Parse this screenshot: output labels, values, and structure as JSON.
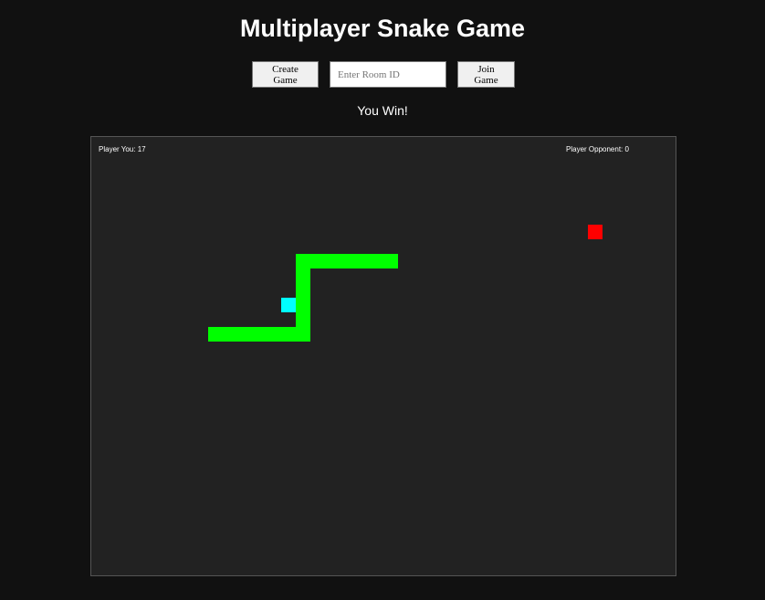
{
  "header": {
    "title": "Multiplayer Snake Game"
  },
  "controls": {
    "create_label": "Create Game",
    "room_placeholder": "Enter Room ID",
    "room_value": "",
    "join_label": "Join Game"
  },
  "status": {
    "message": "You Win!"
  },
  "board": {
    "score_you_label": "Player You: 17",
    "score_opponent_label": "Player Opponent: 0",
    "grid_cols": 40,
    "grid_rows": 30,
    "colors": {
      "background": "#222222",
      "snake_you": "#00ff00",
      "snake_opponent": "#00ffff",
      "food": "#ff0000"
    },
    "snake_you": [
      [
        8,
        13
      ],
      [
        9,
        13
      ],
      [
        10,
        13
      ],
      [
        11,
        13
      ],
      [
        12,
        13
      ],
      [
        13,
        13
      ],
      [
        14,
        13
      ],
      [
        14,
        12
      ],
      [
        14,
        11
      ],
      [
        14,
        10
      ],
      [
        14,
        9
      ],
      [
        14,
        8
      ],
      [
        15,
        8
      ],
      [
        16,
        8
      ],
      [
        17,
        8
      ],
      [
        18,
        8
      ],
      [
        19,
        8
      ],
      [
        20,
        8
      ]
    ],
    "snake_opponent": [
      [
        13,
        11
      ]
    ],
    "food": [
      [
        34,
        6
      ]
    ]
  }
}
